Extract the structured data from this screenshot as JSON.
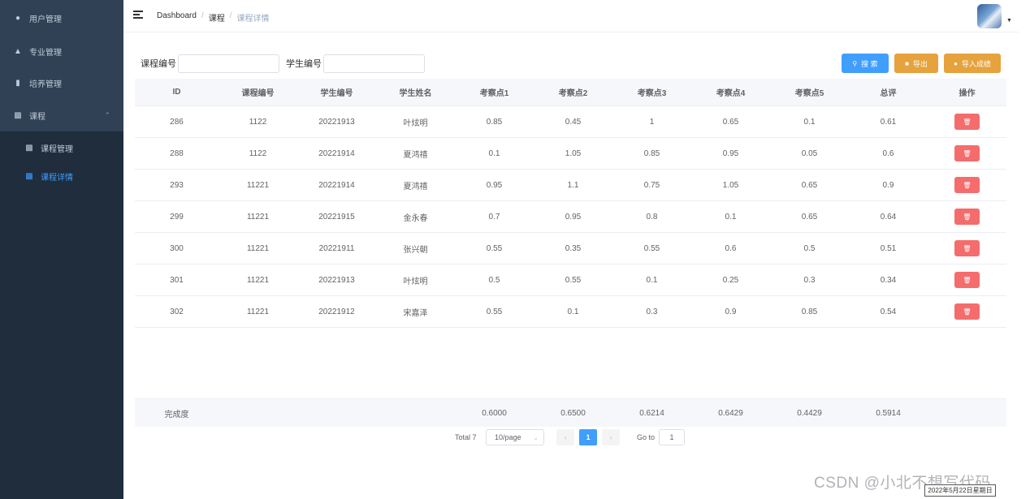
{
  "sidebar": {
    "items": [
      {
        "label": "用户管理",
        "icon": "user-icon"
      },
      {
        "label": "专业管理",
        "icon": "tree-icon"
      },
      {
        "label": "培养管理",
        "icon": "book-icon"
      },
      {
        "label": "课程",
        "icon": "chart-icon"
      },
      {
        "label": "课程管理",
        "icon": "chart-icon"
      },
      {
        "label": "课程详情",
        "icon": "chart-icon"
      }
    ]
  },
  "header": {
    "breadcrumb": [
      "Dashboard",
      "课程",
      "课程详情"
    ]
  },
  "search": {
    "course_label": "课程编号",
    "student_label": "学生编号",
    "course_value": "",
    "student_value": ""
  },
  "buttons": {
    "search": "搜 索",
    "export": "导出",
    "import": "导入成绩"
  },
  "table": {
    "headers": [
      "ID",
      "课程编号",
      "学生编号",
      "学生姓名",
      "考察点1",
      "考察点2",
      "考察点3",
      "考察点4",
      "考察点5",
      "总评",
      "操作"
    ],
    "rows": [
      [
        "286",
        "1122",
        "20221913",
        "叶炫明",
        "0.85",
        "0.45",
        "1",
        "0.65",
        "0.1",
        "0.61"
      ],
      [
        "288",
        "1122",
        "20221914",
        "夏鸿禧",
        "0.1",
        "1.05",
        "0.85",
        "0.95",
        "0.05",
        "0.6"
      ],
      [
        "293",
        "11221",
        "20221914",
        "夏鸿禧",
        "0.95",
        "1.1",
        "0.75",
        "1.05",
        "0.65",
        "0.9"
      ],
      [
        "299",
        "11221",
        "20221915",
        "金永春",
        "0.7",
        "0.95",
        "0.8",
        "0.1",
        "0.65",
        "0.64"
      ],
      [
        "300",
        "11221",
        "20221911",
        "张兴朝",
        "0.55",
        "0.35",
        "0.55",
        "0.6",
        "0.5",
        "0.51"
      ],
      [
        "301",
        "11221",
        "20221913",
        "叶炫明",
        "0.5",
        "0.55",
        "0.1",
        "0.25",
        "0.3",
        "0.34"
      ],
      [
        "302",
        "11221",
        "20221912",
        "宋嘉泽",
        "0.55",
        "0.1",
        "0.3",
        "0.9",
        "0.85",
        "0.54"
      ]
    ],
    "footer": {
      "label": "完成度",
      "values": [
        "0.6000",
        "0.6500",
        "0.6214",
        "0.6429",
        "0.4429",
        "0.5914"
      ]
    }
  },
  "pagination": {
    "total": "Total 7",
    "page_size": "10/page",
    "current": "1",
    "goto_label": "Go to",
    "goto_value": "1"
  },
  "watermark": "CSDN @小北不想写代码",
  "date_box": "2022年5月22日星期日",
  "colors": {
    "sidebar_bg": "#304156",
    "primary": "#409eff",
    "warning": "#e6a23c",
    "danger": "#f56c6c"
  }
}
